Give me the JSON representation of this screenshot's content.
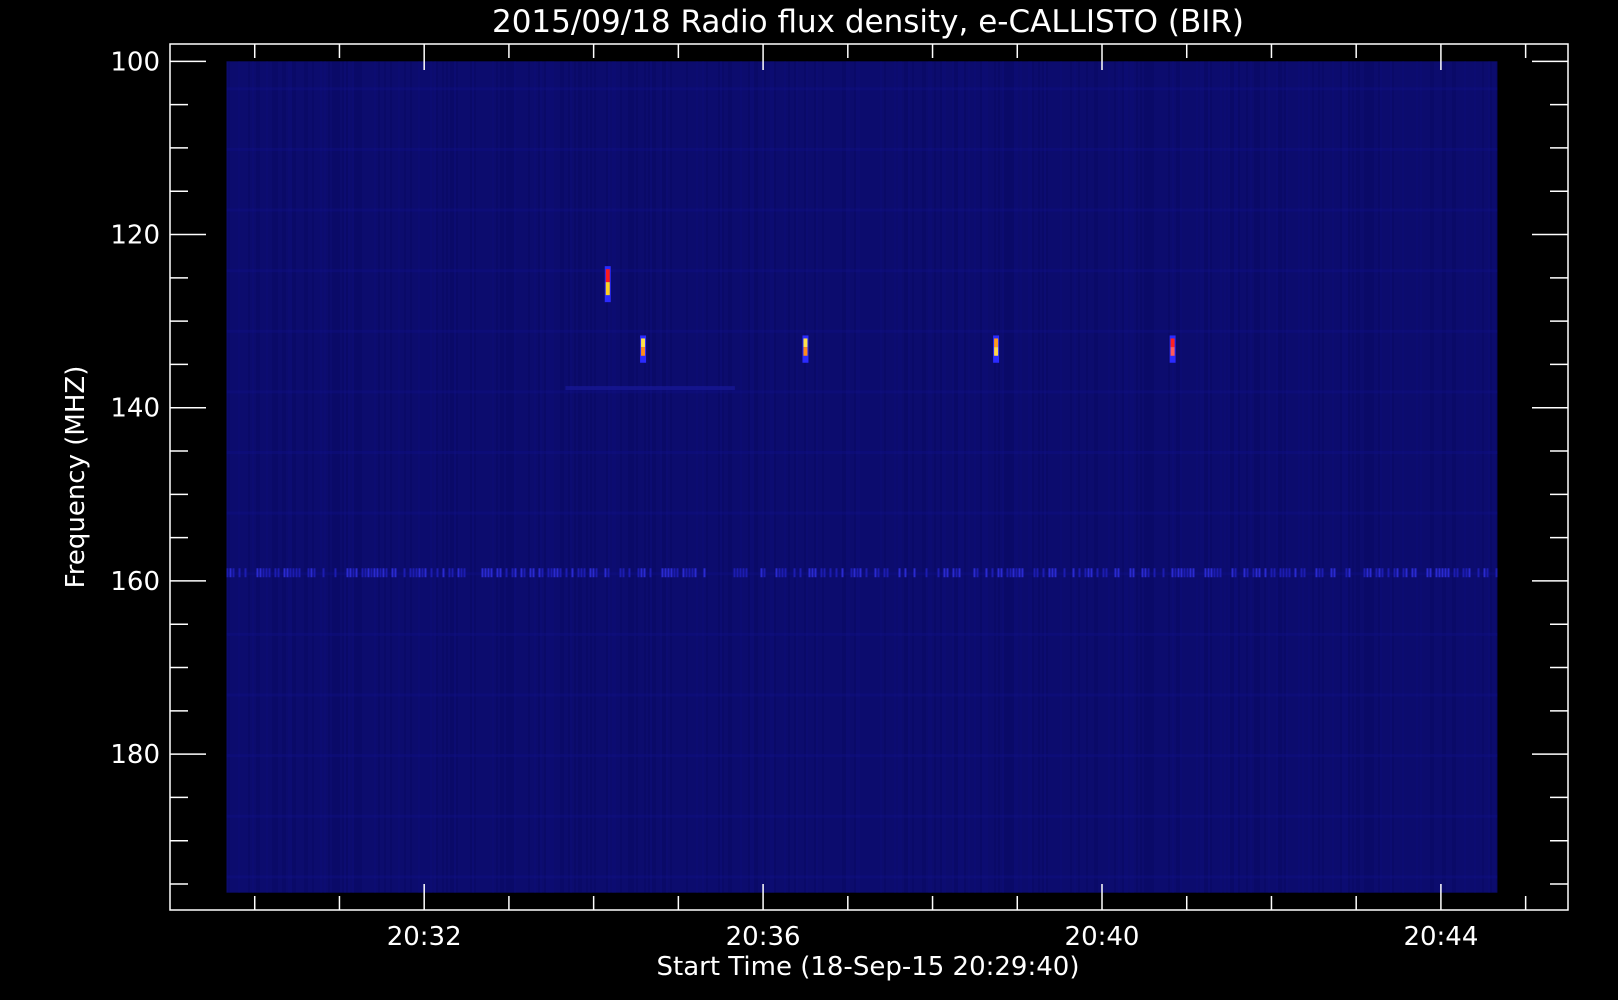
{
  "chart_data": {
    "type": "heatmap",
    "title": "2015/09/18  Radio flux density, e-CALLISTO (BIR)",
    "xlabel": "Start Time (18-Sep-15 20:29:40)",
    "ylabel": "Frequency (MHZ)",
    "x_tick_labels": [
      "20:32",
      "20:36",
      "20:40",
      "20:44"
    ],
    "y_tick_labels": [
      "100",
      "120",
      "140",
      "160",
      "180"
    ],
    "y_ticks": [
      100,
      120,
      140,
      160,
      180
    ],
    "xlim": [
      "20:29:00",
      "20:45:30"
    ],
    "ylim": [
      198,
      98
    ],
    "data_time_range": [
      "20:29:40",
      "20:44:40"
    ],
    "data_freq_range": [
      100,
      196
    ],
    "colormap": "blue-dominated spectrogram (low flux dark blue, bursts yellow/red)",
    "background_color": "#000000",
    "spectrogram_base_color": "#0c0c6e",
    "persistent_band": {
      "frequency_mhz": 159,
      "note": "intermittent interference line"
    },
    "hotspots": [
      {
        "time": "20:34:10",
        "freq_range": [
          124,
          127
        ],
        "peak": "red/yellow"
      },
      {
        "time": "20:34:35",
        "freq_range": [
          132,
          134
        ],
        "peak": "yellow"
      },
      {
        "time": "20:36:30",
        "freq_range": [
          132,
          134
        ],
        "peak": "yellow"
      },
      {
        "time": "20:38:45",
        "freq_range": [
          132,
          134
        ],
        "peak": "orange"
      },
      {
        "time": "20:40:50",
        "freq_range": [
          132,
          134
        ],
        "peak": "red"
      }
    ]
  }
}
